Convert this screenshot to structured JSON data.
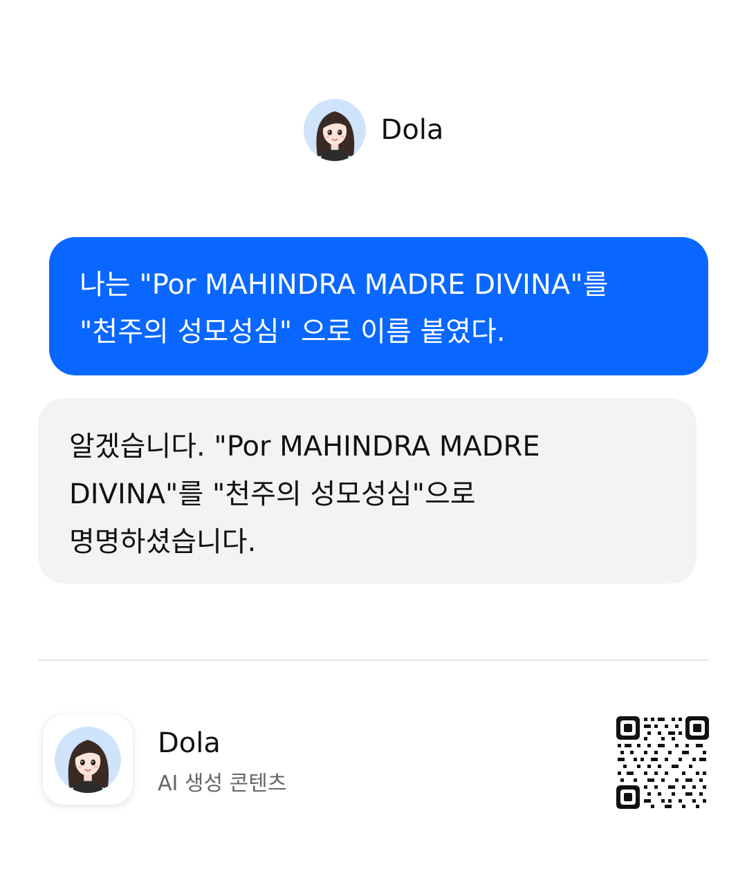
{
  "header": {
    "name": "Dola",
    "avatar_icon": "girl-avatar-icon"
  },
  "messages": [
    {
      "role": "user",
      "text": "나는 \"Por MAHINDRA MADRE DIVINA\"를\n\"천주의 성모성심\" 으로 이름 붙였다."
    },
    {
      "role": "assistant",
      "text": "알겠습니다. \"Por MAHINDRA MADRE\nDIVINA\"를 \"천주의 성모성심\"으로\n명명하셨습니다."
    }
  ],
  "footer": {
    "app_name": "Dola",
    "subtitle": "AI 생성 콘텐츠",
    "qr_icon": "qr-code-icon"
  },
  "colors": {
    "user_bubble": "#0967ff",
    "bot_bubble": "#f3f3f3",
    "divider": "#e5e5e5",
    "avatar_bg": "#cfe3fb"
  }
}
